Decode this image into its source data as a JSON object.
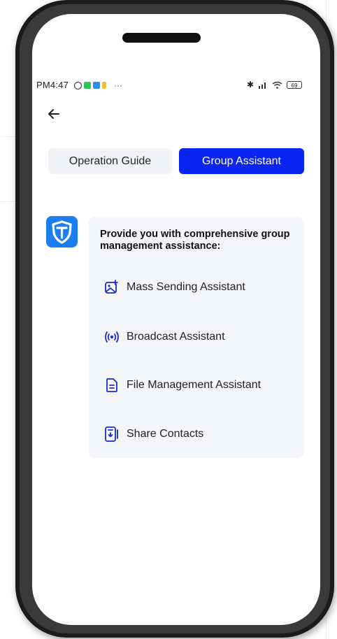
{
  "status_bar": {
    "time": "PM4:47",
    "more": "···",
    "battery": "69"
  },
  "tabs": [
    {
      "label": "Operation Guide",
      "active": false
    },
    {
      "label": "Group Assistant",
      "active": true
    }
  ],
  "card": {
    "title": "Provide you with comprehensive group management assistance:",
    "features": [
      {
        "icon": "image-send-icon",
        "label": "Mass Sending Assistant"
      },
      {
        "icon": "broadcast-icon",
        "label": "Broadcast Assistant"
      },
      {
        "icon": "file-icon",
        "label": "File Management Assistant"
      },
      {
        "icon": "share-contacts-icon",
        "label": "Share Contacts"
      }
    ]
  },
  "colors": {
    "accent": "#0a25f2",
    "logo": "#1c7ef2",
    "card_bg": "#f5f6fa"
  }
}
